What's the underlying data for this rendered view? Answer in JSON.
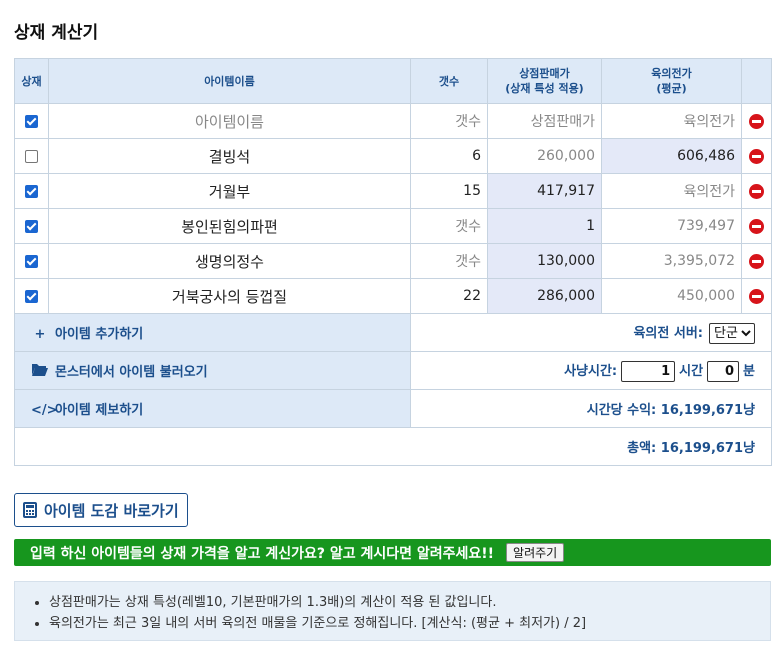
{
  "page_title": "상재 계산기",
  "table": {
    "headers": {
      "check": "상재",
      "name": "아이템이름",
      "count": "갯수",
      "shop_price_line1": "상점판매가",
      "shop_price_line2": "(상재 특성 적용)",
      "market_line1": "육의전가",
      "market_line2": "(평균)"
    },
    "rows": [
      {
        "checked": true,
        "name": "아이템이름",
        "name_ph": true,
        "count": "갯수",
        "count_ph": true,
        "price": "상점판매가",
        "price_ph": true,
        "price_hl": false,
        "market": "육의전가",
        "market_ph": true,
        "market_hl": false
      },
      {
        "checked": false,
        "name": "결빙석",
        "name_ph": false,
        "count": "6",
        "count_ph": false,
        "price": "260,000",
        "price_ph": true,
        "price_hl": false,
        "market": "606,486",
        "market_ph": false,
        "market_hl": true
      },
      {
        "checked": true,
        "name": "거월부",
        "name_ph": false,
        "count": "15",
        "count_ph": false,
        "price": "417,917",
        "price_ph": false,
        "price_hl": true,
        "market": "육의전가",
        "market_ph": true,
        "market_hl": false
      },
      {
        "checked": true,
        "name": "봉인된힘의파편",
        "name_ph": false,
        "count": "갯수",
        "count_ph": true,
        "price": "1",
        "price_ph": false,
        "price_hl": true,
        "market": "739,497",
        "market_ph": true,
        "market_hl": false
      },
      {
        "checked": true,
        "name": "생명의정수",
        "name_ph": false,
        "count": "갯수",
        "count_ph": true,
        "price": "130,000",
        "price_ph": false,
        "price_hl": true,
        "market": "3,395,072",
        "market_ph": true,
        "market_hl": false
      },
      {
        "checked": true,
        "name": "거북궁사의 등껍질",
        "name_ph": false,
        "count": "22",
        "count_ph": false,
        "price": "286,000",
        "price_ph": false,
        "price_hl": true,
        "market": "450,000",
        "market_ph": true,
        "market_hl": false
      }
    ]
  },
  "actions": {
    "add_item": "아이템 추가하기",
    "load_monster": "몬스터에서 아이템 불러오기",
    "report_item": "아이템 제보하기"
  },
  "server": {
    "label": "육의전 서버:",
    "selected": "단군"
  },
  "hunt": {
    "label": "사냥시간:",
    "hours": "1",
    "hours_unit": "시간",
    "minutes": "0",
    "minutes_unit": "분"
  },
  "hourly": {
    "text": "시간당 수익: 16,199,671냥"
  },
  "total": {
    "text": "총액: 16,199,671냥"
  },
  "dict_button": "아이템 도감 바로가기",
  "banner": {
    "text": "입력 하신 아이템들의 상재 가격을 알고 계신가요? 알고 계시다면 알려주세요!!",
    "button": "알려주기"
  },
  "notes": [
    "상점판매가는 상재 특성(레벨10, 기본판매가의 1.3배)의 계산이 적용 된 값입니다.",
    "육의전가는 최근 3일 내의 서버 육의전 매물을 기준으로 정해집니다. [계산식: (평균 + 최저가) / 2]"
  ],
  "colors": {
    "accent": "#1c4f8c",
    "header_bg": "#dde9f7",
    "banner_green": "#17961e",
    "remove_red": "#d7141a",
    "checkbox_blue": "#1a66d1"
  },
  "icons": {
    "add": "plus-icon",
    "load": "folder-open-icon",
    "report": "code-icon",
    "dict": "calculator-icon",
    "remove": "minus-circle-icon"
  }
}
